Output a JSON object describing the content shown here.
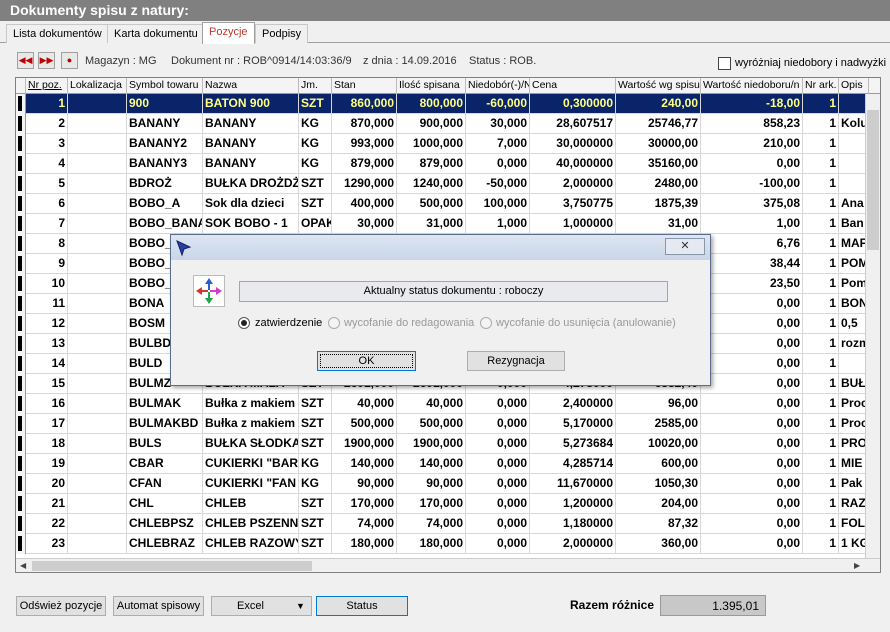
{
  "window": {
    "title": "Dokumenty spisu z natury:"
  },
  "tabs": [
    {
      "label": "Lista dokumentów",
      "active": false
    },
    {
      "label": "Karta dokumentu",
      "active": false
    },
    {
      "label": "Pozycje",
      "active": true
    },
    {
      "label": "Podpisy",
      "active": false
    }
  ],
  "info": {
    "magazyn": "Magazyn : MG",
    "dokument": "Dokument nr : ROB^0914/14:03:36/9",
    "data": "z dnia : 14.09.2016",
    "status": "Status : ROB."
  },
  "highlight_checkbox": {
    "label": "wyróżniaj niedobory i nadwyżki",
    "checked": false
  },
  "icons": {
    "first": "first-record-icon",
    "prev": "previous-record-icon",
    "stop": "record-icon",
    "dialog_app": "cursor-app-icon",
    "dialog_status": "four-arrows-icon",
    "close": "close-icon"
  },
  "colors": {
    "selected_row_bg": "#0a246a",
    "selected_row_fg": "#ffff80",
    "tab_active_fg": "#c0392b"
  },
  "table": {
    "columns": [
      "Nr poz.",
      "Lokalizacja",
      "Symbol towaru",
      "Nazwa",
      "Jm.",
      "Stan",
      "Ilość spisana",
      "Niedobór(-)/N",
      "Cena",
      "Wartość wg spisu",
      "Wartość niedoboru/n",
      "Nr ark.",
      "Opis"
    ],
    "rows": [
      {
        "nr": "1",
        "lok": "",
        "sym": "900",
        "nazwa": "BATON 900",
        "jm": "SZT",
        "stan": "860,000",
        "ilosc": "800,000",
        "nied": "-60,000",
        "cena": "0,300000",
        "wart": "240,00",
        "wniedob": "-18,00",
        "ark": "1",
        "opis": "",
        "selected": true
      },
      {
        "nr": "2",
        "lok": "",
        "sym": "BANANY",
        "nazwa": "BANANY",
        "jm": "KG",
        "stan": "870,000",
        "ilosc": "900,000",
        "nied": "30,000",
        "cena": "28,607517",
        "wart": "25746,77",
        "wniedob": "858,23",
        "ark": "1",
        "opis": "Kolu"
      },
      {
        "nr": "3",
        "lok": "",
        "sym": "BANANY2",
        "nazwa": "BANANY",
        "jm": "KG",
        "stan": "993,000",
        "ilosc": "1000,000",
        "nied": "7,000",
        "cena": "30,000000",
        "wart": "30000,00",
        "wniedob": "210,00",
        "ark": "1",
        "opis": ""
      },
      {
        "nr": "4",
        "lok": "",
        "sym": "BANANY3",
        "nazwa": "BANANY",
        "jm": "KG",
        "stan": "879,000",
        "ilosc": "879,000",
        "nied": "0,000",
        "cena": "40,000000",
        "wart": "35160,00",
        "wniedob": "0,00",
        "ark": "1",
        "opis": ""
      },
      {
        "nr": "5",
        "lok": "",
        "sym": "BDROŻ",
        "nazwa": "BUŁKA DROŻDŻ",
        "jm": "SZT",
        "stan": "1290,000",
        "ilosc": "1240,000",
        "nied": "-50,000",
        "cena": "2,000000",
        "wart": "2480,00",
        "wniedob": "-100,00",
        "ark": "1",
        "opis": ""
      },
      {
        "nr": "6",
        "lok": "",
        "sym": "BOBO_A",
        "nazwa": "Sok dla dzieci",
        "jm": "SZT",
        "stan": "400,000",
        "ilosc": "500,000",
        "nied": "100,000",
        "cena": "3,750775",
        "wart": "1875,39",
        "wniedob": "375,08",
        "ark": "1",
        "opis": "Ana"
      },
      {
        "nr": "7",
        "lok": "",
        "sym": "BOBO_BANA",
        "nazwa": "SOK BOBO - 1",
        "jm": "OPAK",
        "stan": "30,000",
        "ilosc": "31,000",
        "nied": "1,000",
        "cena": "1,000000",
        "wart": "31,00",
        "wniedob": "1,00",
        "ark": "1",
        "opis": "Ban"
      },
      {
        "nr": "8",
        "lok": "",
        "sym": "BOBO_",
        "nazwa": "",
        "jm": "",
        "stan": "",
        "ilosc": "",
        "nied": "",
        "cena": "",
        "wart": "",
        "wniedob": "6,76",
        "ark": "1",
        "opis": "MAF"
      },
      {
        "nr": "9",
        "lok": "",
        "sym": "BOBO_",
        "nazwa": "",
        "jm": "",
        "stan": "",
        "ilosc": "",
        "nied": "",
        "cena": "",
        "wart": "",
        "wniedob": "38,44",
        "ark": "1",
        "opis": "POM"
      },
      {
        "nr": "10",
        "lok": "",
        "sym": "BOBO_",
        "nazwa": "",
        "jm": "",
        "stan": "",
        "ilosc": "",
        "nied": "",
        "cena": "",
        "wart": "",
        "wniedob": "23,50",
        "ark": "1",
        "opis": "Pom"
      },
      {
        "nr": "11",
        "lok": "",
        "sym": "BONA",
        "nazwa": "",
        "jm": "",
        "stan": "",
        "ilosc": "",
        "nied": "",
        "cena": "",
        "wart": "",
        "wniedob": "0,00",
        "ark": "1",
        "opis": "BON"
      },
      {
        "nr": "12",
        "lok": "",
        "sym": "BOSM",
        "nazwa": "",
        "jm": "",
        "stan": "",
        "ilosc": "",
        "nied": "",
        "cena": "",
        "wart": "",
        "wniedob": "0,00",
        "ark": "1",
        "opis": "0,5"
      },
      {
        "nr": "13",
        "lok": "",
        "sym": "BULBD",
        "nazwa": "",
        "jm": "",
        "stan": "",
        "ilosc": "",
        "nied": "",
        "cena": "",
        "wart": "",
        "wniedob": "0,00",
        "ark": "1",
        "opis": "rozm"
      },
      {
        "nr": "14",
        "lok": "",
        "sym": "BULD",
        "nazwa": "",
        "jm": "",
        "stan": "",
        "ilosc": "",
        "nied": "",
        "cena": "",
        "wart": "",
        "wniedob": "0,00",
        "ark": "1",
        "opis": ""
      },
      {
        "nr": "15",
        "lok": "",
        "sym": "BULMZ",
        "nazwa": "BUŁKA MAŁA",
        "jm": "SZT",
        "stan": "2601,000",
        "ilosc": "2601,000",
        "nied": "0,000",
        "cena": "4,273000",
        "wart": "6382,40",
        "wniedob": "0,00",
        "ark": "1",
        "opis": "BUŁ"
      },
      {
        "nr": "16",
        "lok": "",
        "sym": "BULMAK",
        "nazwa": "Bułka z makiem",
        "jm": "SZT",
        "stan": "40,000",
        "ilosc": "40,000",
        "nied": "0,000",
        "cena": "2,400000",
        "wart": "96,00",
        "wniedob": "0,00",
        "ark": "1",
        "opis": "Proc"
      },
      {
        "nr": "17",
        "lok": "",
        "sym": "BULMAKBD",
        "nazwa": "Bułka z makiem",
        "jm": "SZT",
        "stan": "500,000",
        "ilosc": "500,000",
        "nied": "0,000",
        "cena": "5,170000",
        "wart": "2585,00",
        "wniedob": "0,00",
        "ark": "1",
        "opis": "Proc"
      },
      {
        "nr": "18",
        "lok": "",
        "sym": "BULS",
        "nazwa": "BUŁKA SŁODKA",
        "jm": "SZT",
        "stan": "1900,000",
        "ilosc": "1900,000",
        "nied": "0,000",
        "cena": "5,273684",
        "wart": "10020,00",
        "wniedob": "0,00",
        "ark": "1",
        "opis": "PRO"
      },
      {
        "nr": "19",
        "lok": "",
        "sym": "CBAR",
        "nazwa": "CUKIERKI \"BAR",
        "jm": "KG",
        "stan": "140,000",
        "ilosc": "140,000",
        "nied": "0,000",
        "cena": "4,285714",
        "wart": "600,00",
        "wniedob": "0,00",
        "ark": "1",
        "opis": "MIE"
      },
      {
        "nr": "20",
        "lok": "",
        "sym": "CFAN",
        "nazwa": "CUKIERKI \"FAN",
        "jm": "KG",
        "stan": "90,000",
        "ilosc": "90,000",
        "nied": "0,000",
        "cena": "11,670000",
        "wart": "1050,30",
        "wniedob": "0,00",
        "ark": "1",
        "opis": "Pak"
      },
      {
        "nr": "21",
        "lok": "",
        "sym": "CHL",
        "nazwa": "CHLEB",
        "jm": "SZT",
        "stan": "170,000",
        "ilosc": "170,000",
        "nied": "0,000",
        "cena": "1,200000",
        "wart": "204,00",
        "wniedob": "0,00",
        "ark": "1",
        "opis": "RAZ"
      },
      {
        "nr": "22",
        "lok": "",
        "sym": "CHLEBPSZ",
        "nazwa": "CHLEB PSZENN",
        "jm": "SZT",
        "stan": "74,000",
        "ilosc": "74,000",
        "nied": "0,000",
        "cena": "1,180000",
        "wart": "87,32",
        "wniedob": "0,00",
        "ark": "1",
        "opis": "FOL"
      },
      {
        "nr": "23",
        "lok": "",
        "sym": "CHLEBRAZ",
        "nazwa": "CHLEB RAZOWY",
        "jm": "SZT",
        "stan": "180,000",
        "ilosc": "180,000",
        "nied": "0,000",
        "cena": "2,000000",
        "wart": "360,00",
        "wniedob": "0,00",
        "ark": "1",
        "opis": "1 KG"
      }
    ]
  },
  "buttons": {
    "refresh": "Odśwież pozycje",
    "auto": "Automat spisowy",
    "excel": "Excel",
    "status": "Status"
  },
  "razem": {
    "label": "Razem różnice",
    "value": "1.395,01"
  },
  "dialog": {
    "status_text": "Aktualny status dokumentu : roboczy",
    "options": [
      {
        "label": "zatwierdzenie",
        "selected": true,
        "enabled": true
      },
      {
        "label": "wycofanie do redagowania",
        "selected": false,
        "enabled": false
      },
      {
        "label": "wycofanie do usunięcia (anulowanie)",
        "selected": false,
        "enabled": false
      }
    ],
    "ok_label": "OK",
    "cancel_label": "Rezygnacja"
  }
}
